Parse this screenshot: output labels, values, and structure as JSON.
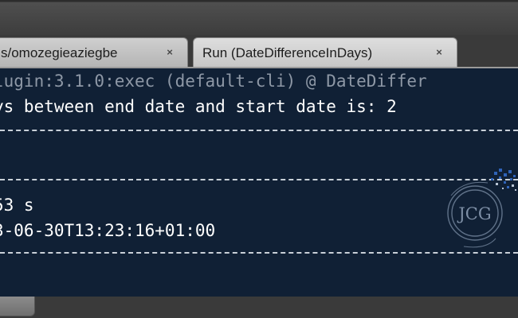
{
  "tabs": [
    {
      "label": "s/omozegieaziegbe",
      "active": false,
      "close_icon": "close-icon"
    },
    {
      "label": "Run (DateDifferenceInDays)",
      "active": true,
      "close_icon": "close-icon"
    }
  ],
  "close_glyph": "×",
  "console": {
    "lines": [
      "lugin:3.1.0:exec (default-cli) @ DateDiffer",
      "ys between end date and start date is: 2",
      "----------------------------------------------------------------",
      "",
      "----------------------------------------------------------------",
      "53 s",
      "3-06-30T13:23:16+01:00",
      "----------------------------------------------------------------"
    ],
    "background": "#102035",
    "text_color": "#ffffff"
  },
  "watermark": {
    "text": "JCG",
    "icon": "jcg-logo-icon"
  }
}
